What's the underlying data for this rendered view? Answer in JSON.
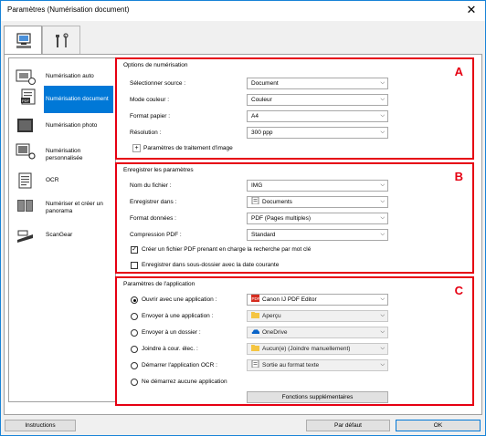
{
  "window": {
    "title": "Paramètres (Numérisation document)",
    "close_glyph": "✕"
  },
  "tabs": [
    {
      "icon": "computer-scan-icon",
      "active": true
    },
    {
      "icon": "tools-icon",
      "active": false
    }
  ],
  "sidebar": {
    "items": [
      {
        "label": "Numérisation auto",
        "icon": "auto-scan-icon",
        "selected": false
      },
      {
        "label": "Numérisation document",
        "icon": "document-scan-icon",
        "selected": true
      },
      {
        "label": "Numérisation photo",
        "icon": "photo-scan-icon",
        "selected": false
      },
      {
        "label": "Numérisation personnalisée",
        "icon": "custom-scan-icon",
        "selected": false
      },
      {
        "label": "OCR",
        "icon": "ocr-icon",
        "selected": false
      },
      {
        "label": "Numériser et créer un panorama",
        "icon": "panorama-icon",
        "selected": false
      },
      {
        "label": "ScanGear",
        "icon": "scangear-icon",
        "selected": false
      }
    ]
  },
  "scan_options": {
    "title": "Options de numérisation",
    "badge": "A",
    "rows": [
      {
        "label": "Sélectionner source :",
        "value": "Document"
      },
      {
        "label": "Mode couleur :",
        "value": "Couleur"
      },
      {
        "label": "Format papier :",
        "value": "A4"
      },
      {
        "label": "Résolution :",
        "value": "300 ppp"
      }
    ],
    "image_processing_label": "Paramètres de traitement d'image",
    "expand_glyph": "+"
  },
  "save_settings": {
    "title": "Enregistrer les paramètres",
    "badge": "B",
    "rows": [
      {
        "label": "Nom du fichier :",
        "value": "IMG"
      },
      {
        "label": "Enregistrer dans :",
        "value": "Documents"
      },
      {
        "label": "Format données :",
        "value": "PDF (Pages multiples)"
      },
      {
        "label": "Compression PDF :",
        "value": "Standard"
      }
    ],
    "check_searchable_pdf": {
      "label": "Créer un fichier PDF prenant en charge la recherche par mot clé",
      "checked": true
    },
    "check_subfolder": {
      "label": "Enregistrer dans sous-dossier avec la date courante",
      "checked": false
    },
    "check_glyph": "✓"
  },
  "app_settings": {
    "title": "Paramètres de l'application",
    "badge": "C",
    "rows": [
      {
        "label": "Ouvrir avec une application :",
        "value": "Canon IJ PDF Editor",
        "selected": true,
        "enabled": true
      },
      {
        "label": "Envoyer à une application :",
        "value": "Aperçu",
        "selected": false,
        "enabled": false
      },
      {
        "label": "Envoyer à un dossier :",
        "value": "OneDrive",
        "selected": false,
        "enabled": false
      },
      {
        "label": "Joindre à cour. élec. :",
        "value": "Aucun(e) (Joindre manuellement)",
        "selected": false,
        "enabled": false
      },
      {
        "label": "Démarrer l'application OCR :",
        "value": "Sortie au format texte",
        "selected": false,
        "enabled": false
      }
    ],
    "no_app_label": "Ne démarrez aucune application",
    "more_functions_label": "Fonctions supplémentaires"
  },
  "footer": {
    "instructions_label": "Instructions",
    "default_label": "Par défaut",
    "ok_label": "OK"
  },
  "colors": {
    "accent": "#0078d7",
    "highlight_border": "#e60012"
  }
}
